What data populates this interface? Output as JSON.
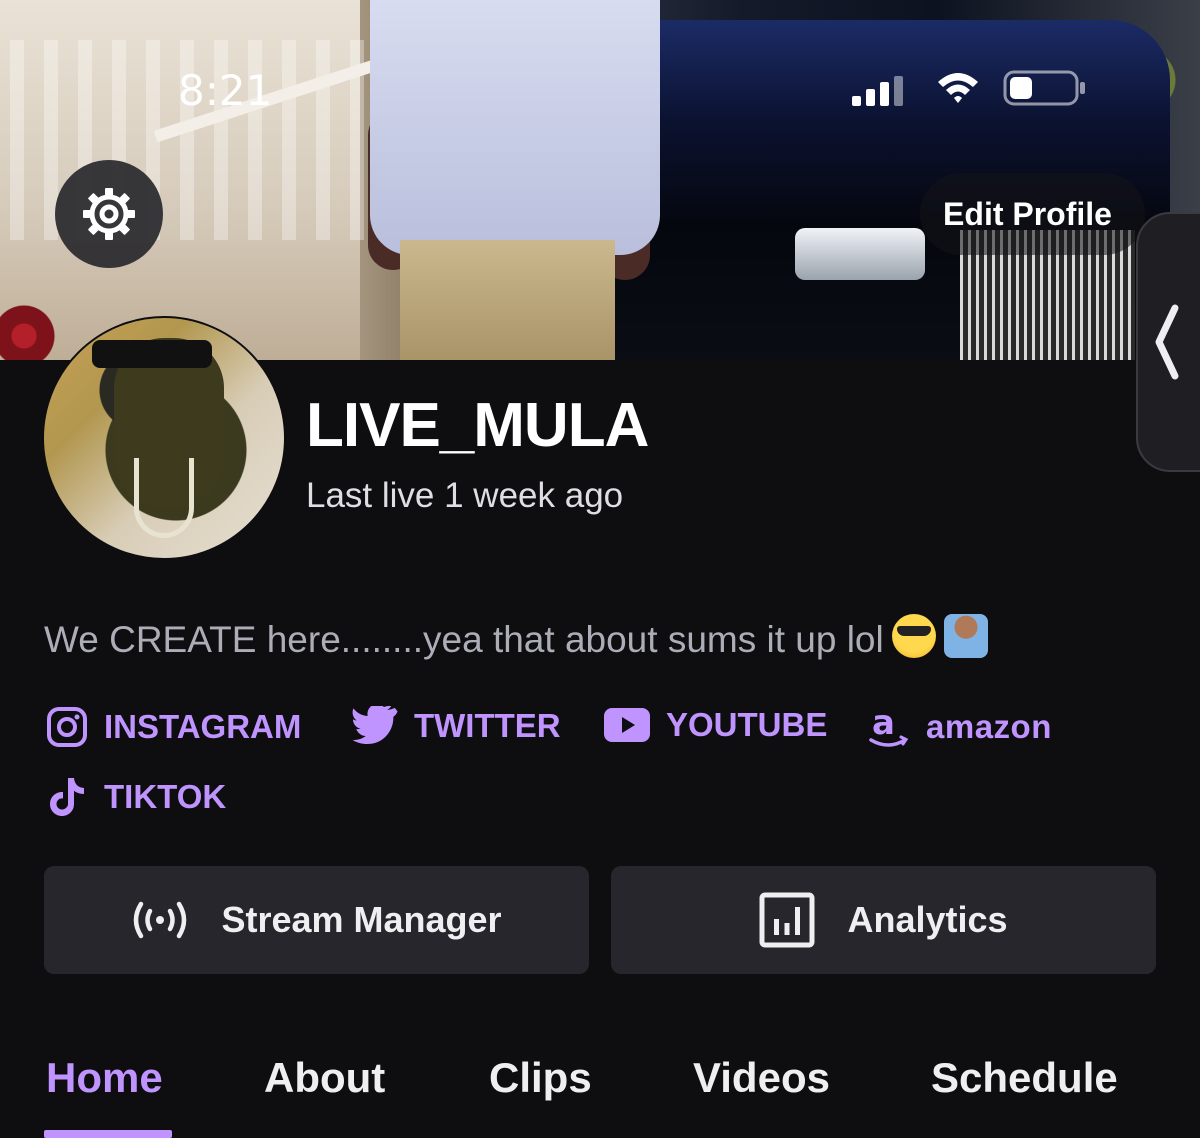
{
  "status_bar": {
    "time": "8:21"
  },
  "header": {
    "edit_profile_label": "Edit Profile"
  },
  "profile": {
    "username": "LIVE_MULA",
    "last_live": "Last live 1 week ago",
    "bio": "We CREATE here........yea that about sums it up lol"
  },
  "social_links": [
    {
      "label": "INSTAGRAM",
      "icon": "instagram-icon"
    },
    {
      "label": "TWITTER",
      "icon": "twitter-icon"
    },
    {
      "label": "YOUTUBE",
      "icon": "youtube-icon"
    },
    {
      "label": "amazon",
      "icon": "amazon-icon"
    },
    {
      "label": "TIKTOK",
      "icon": "tiktok-icon"
    }
  ],
  "actions": {
    "stream_manager_label": "Stream Manager",
    "analytics_label": "Analytics"
  },
  "tabs": [
    {
      "label": "Home",
      "active": true
    },
    {
      "label": "About",
      "active": false
    },
    {
      "label": "Clips",
      "active": false
    },
    {
      "label": "Videos",
      "active": false
    },
    {
      "label": "Schedule",
      "active": false
    }
  ],
  "colors": {
    "accent": "#bf94ff",
    "background": "#0e0e10",
    "button_bg": "#26262c",
    "muted_text": "#adadb8"
  }
}
